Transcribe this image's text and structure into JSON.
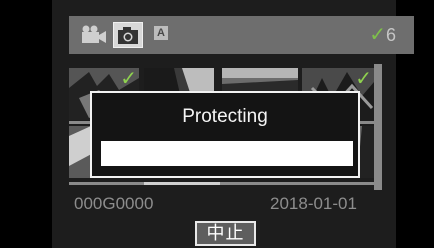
{
  "mode_bar": {
    "icons": [
      "video-camera-icon",
      "photo-camera-icon",
      "auto-mode-icon"
    ],
    "auto_label": "A",
    "selected_check": "✓",
    "selected_count": "6",
    "check_color": "#7ec04a"
  },
  "dialog": {
    "title": "Protecting",
    "progress": 1.0
  },
  "file": {
    "name": "000G0000",
    "date": "2018-01-01"
  },
  "actions": {
    "stop_label": "中止"
  }
}
